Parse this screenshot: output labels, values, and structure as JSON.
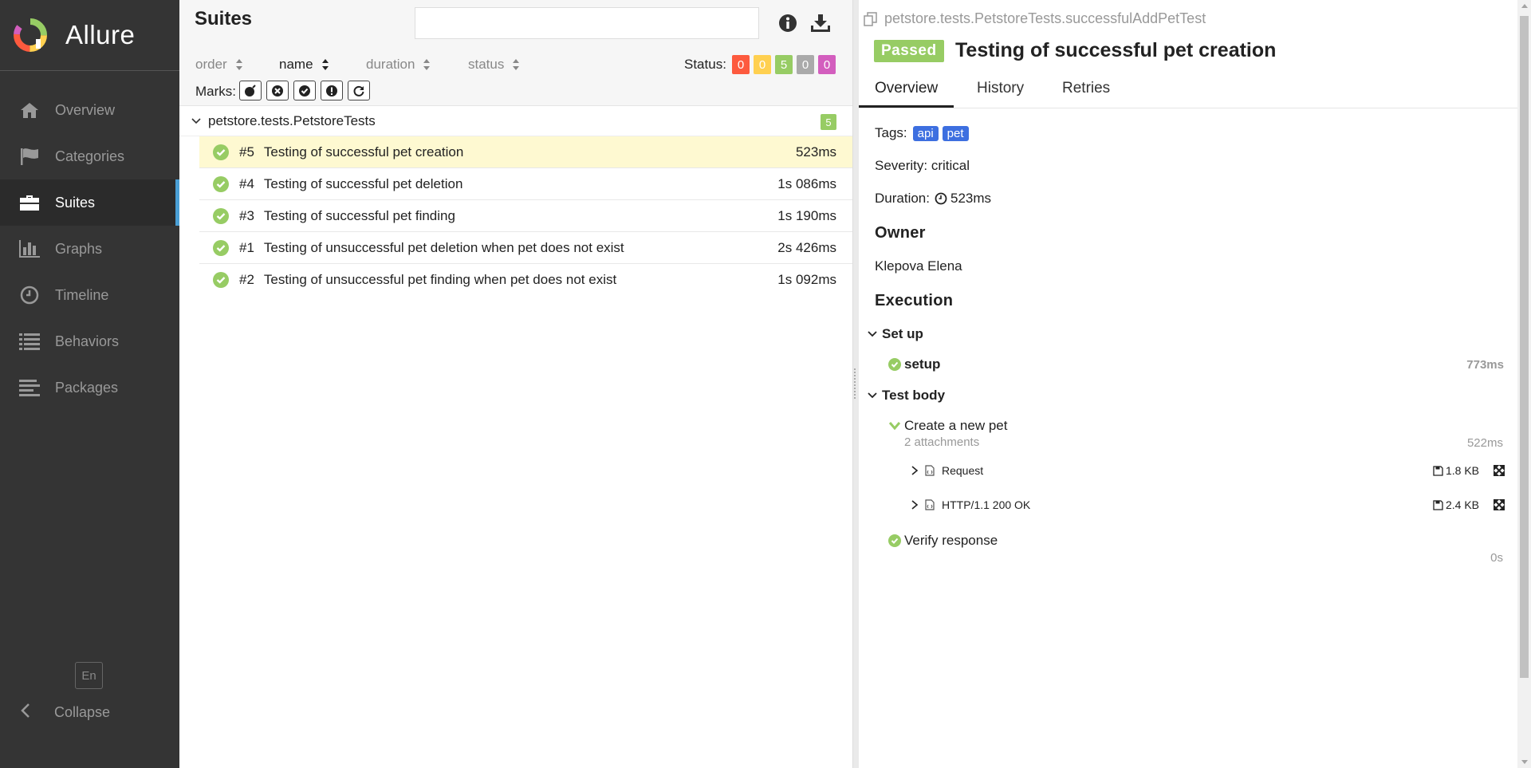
{
  "app": {
    "name": "Allure"
  },
  "sidebar": {
    "items": [
      {
        "label": "Overview",
        "icon": "home-icon"
      },
      {
        "label": "Categories",
        "icon": "flag-icon"
      },
      {
        "label": "Suites",
        "icon": "briefcase-icon",
        "active": true
      },
      {
        "label": "Graphs",
        "icon": "bar-chart-icon"
      },
      {
        "label": "Timeline",
        "icon": "clock-icon"
      },
      {
        "label": "Behaviors",
        "icon": "list-icon"
      },
      {
        "label": "Packages",
        "icon": "align-left-icon"
      }
    ],
    "lang": "En",
    "collapse": "Collapse"
  },
  "suites": {
    "title": "Suites",
    "search_placeholder": "",
    "sort": {
      "order": "order",
      "name": "name",
      "duration": "duration",
      "status": "status"
    },
    "status_label": "Status:",
    "status_counts": [
      {
        "value": "0",
        "color": "#fd5a3e"
      },
      {
        "value": "0",
        "color": "#ffd050"
      },
      {
        "value": "5",
        "color": "#97cc64"
      },
      {
        "value": "0",
        "color": "#aaaaaa"
      },
      {
        "value": "0",
        "color": "#d35ebe"
      }
    ],
    "marks_label": "Marks:",
    "group": {
      "name": "petstore.tests.PetstoreTests",
      "count": "5"
    },
    "rows": [
      {
        "num": "#5",
        "name": "Testing of successful pet creation",
        "duration": "523ms"
      },
      {
        "num": "#4",
        "name": "Testing of successful pet deletion",
        "duration": "1s 086ms"
      },
      {
        "num": "#3",
        "name": "Testing of successful pet finding",
        "duration": "1s 190ms"
      },
      {
        "num": "#1",
        "name": "Testing of unsuccessful pet deletion when pet does not exist",
        "duration": "2s 426ms"
      },
      {
        "num": "#2",
        "name": "Testing of unsuccessful pet finding when pet does not exist",
        "duration": "1s 092ms"
      }
    ]
  },
  "detail": {
    "breadcrumb": "petstore.tests.PetstoreTests.successfulAddPetTest",
    "status": "Passed",
    "title": "Testing of successful pet creation",
    "tabs": [
      "Overview",
      "History",
      "Retries"
    ],
    "tags_label": "Tags:",
    "tags": [
      "api",
      "pet"
    ],
    "severity": "Severity: critical",
    "duration_label": "Duration:",
    "duration": "523ms",
    "owner_heading": "Owner",
    "owner": "Klepova Elena",
    "execution_heading": "Execution",
    "setup_heading": "Set up",
    "setup_step": {
      "name": "setup",
      "duration": "773ms"
    },
    "body_heading": "Test body",
    "create_step": {
      "name": "Create a new pet",
      "sub": "2 attachments",
      "duration": "522ms"
    },
    "attachments": [
      {
        "name": "Request",
        "size": "1.8 KB"
      },
      {
        "name": "HTTP/1.1 200 OK",
        "size": "2.4 KB"
      }
    ],
    "verify_step": {
      "name": "Verify response",
      "duration": "0s"
    }
  }
}
